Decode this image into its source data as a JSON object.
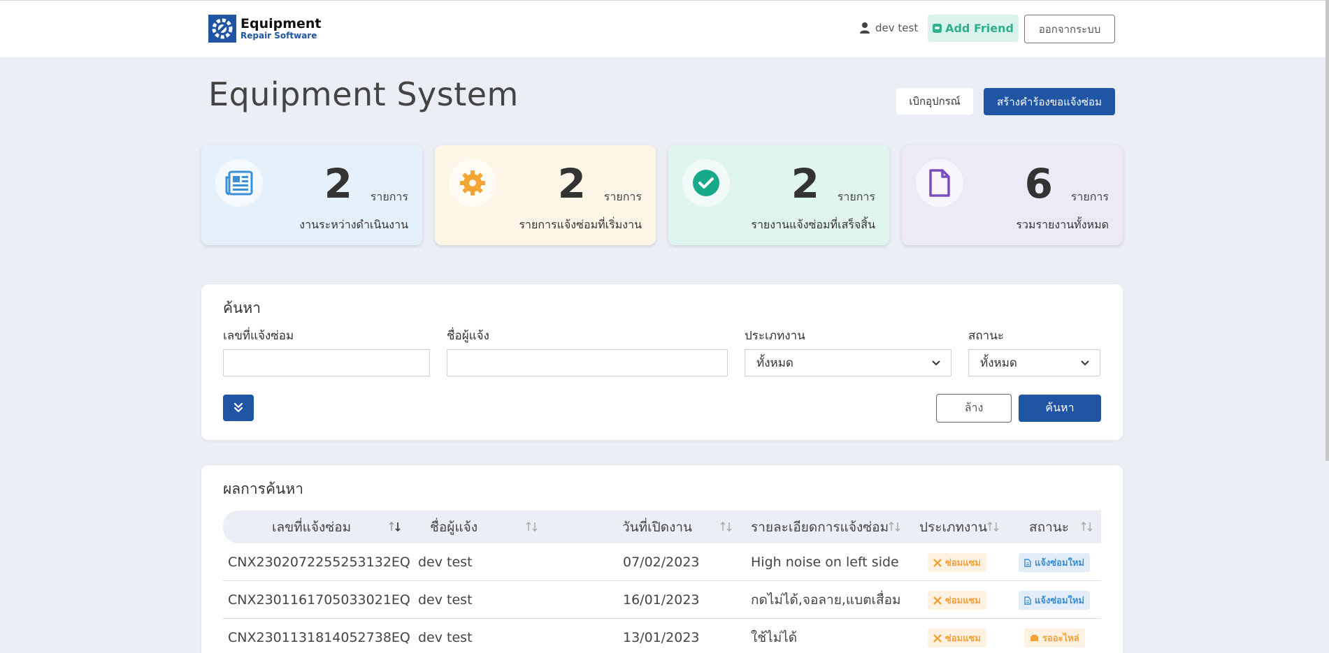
{
  "header": {
    "logo_title": "Equipment",
    "logo_subtitle": "Repair Software",
    "user_name": "dev test",
    "add_friend_label": "Add Friend",
    "logout_label": "ออกจากระบบ"
  },
  "page": {
    "title": "Equipment System",
    "borrow_button": "เบิกอุปกรณ์",
    "create_button": "สร้างคำร้องขอแจ้งซ่อม"
  },
  "stats": [
    {
      "count": "2",
      "unit": "รายการ",
      "label": "งานระหว่างดำเนินงาน",
      "icon": "newspaper-icon",
      "color": "#3a8fd6"
    },
    {
      "count": "2",
      "unit": "รายการ",
      "label": "รายการแจ้งซ่อมที่เริ่มงาน",
      "icon": "gear-icon",
      "color": "#f3a534"
    },
    {
      "count": "2",
      "unit": "รายการ",
      "label": "รายงานแจ้งซ่อมที่เสร็จสิ้น",
      "icon": "check-circle-icon",
      "color": "#18a98b"
    },
    {
      "count": "6",
      "unit": "รายการ",
      "label": "รวมรายงานทั้งหมด",
      "icon": "file-icon",
      "color": "#7b4cc0"
    }
  ],
  "search": {
    "title": "ค้นหา",
    "fields": {
      "repair_no_label": "เลขที่แจ้งซ่อม",
      "repair_no_value": "",
      "reporter_label": "ชื่อผู้แจ้ง",
      "reporter_value": "",
      "job_type_label": "ประเภทงาน",
      "job_type_value": "ทั้งหมด",
      "status_label": "สถานะ",
      "status_value": "ทั้งหมด"
    },
    "clear_button": "ล้าง",
    "search_button": "ค้นหา"
  },
  "results": {
    "title": "ผลการค้นหา",
    "columns": [
      "เลขที่แจ้งซ่อม",
      "ชื่อผู้แจ้ง",
      "วันที่เปิดงาน",
      "รายละเอียดการแจ้งซ่อม",
      "ประเภทงาน",
      "สถานะ"
    ],
    "rows": [
      {
        "repair_no": "CNX2302072255253132EQ",
        "reporter": "dev test",
        "date": "07/02/2023",
        "detail": "High noise on left side",
        "type": "ซ่อมแซม",
        "status": "แจ้งซ่อมใหม่"
      },
      {
        "repair_no": "CNX2301161705033021EQ",
        "reporter": "dev test",
        "date": "16/01/2023",
        "detail": "กดไม่ได้,จอลาย,แบตเสื่อม",
        "type": "ซ่อมแซม",
        "status": "แจ้งซ่อมใหม่"
      },
      {
        "repair_no": "CNX2301131814052738EQ",
        "reporter": "dev test",
        "date": "13/01/2023",
        "detail": "ใช้ไม่ได้",
        "type": "ซ่อมแซม",
        "status": "รออะไหล่"
      }
    ]
  }
}
